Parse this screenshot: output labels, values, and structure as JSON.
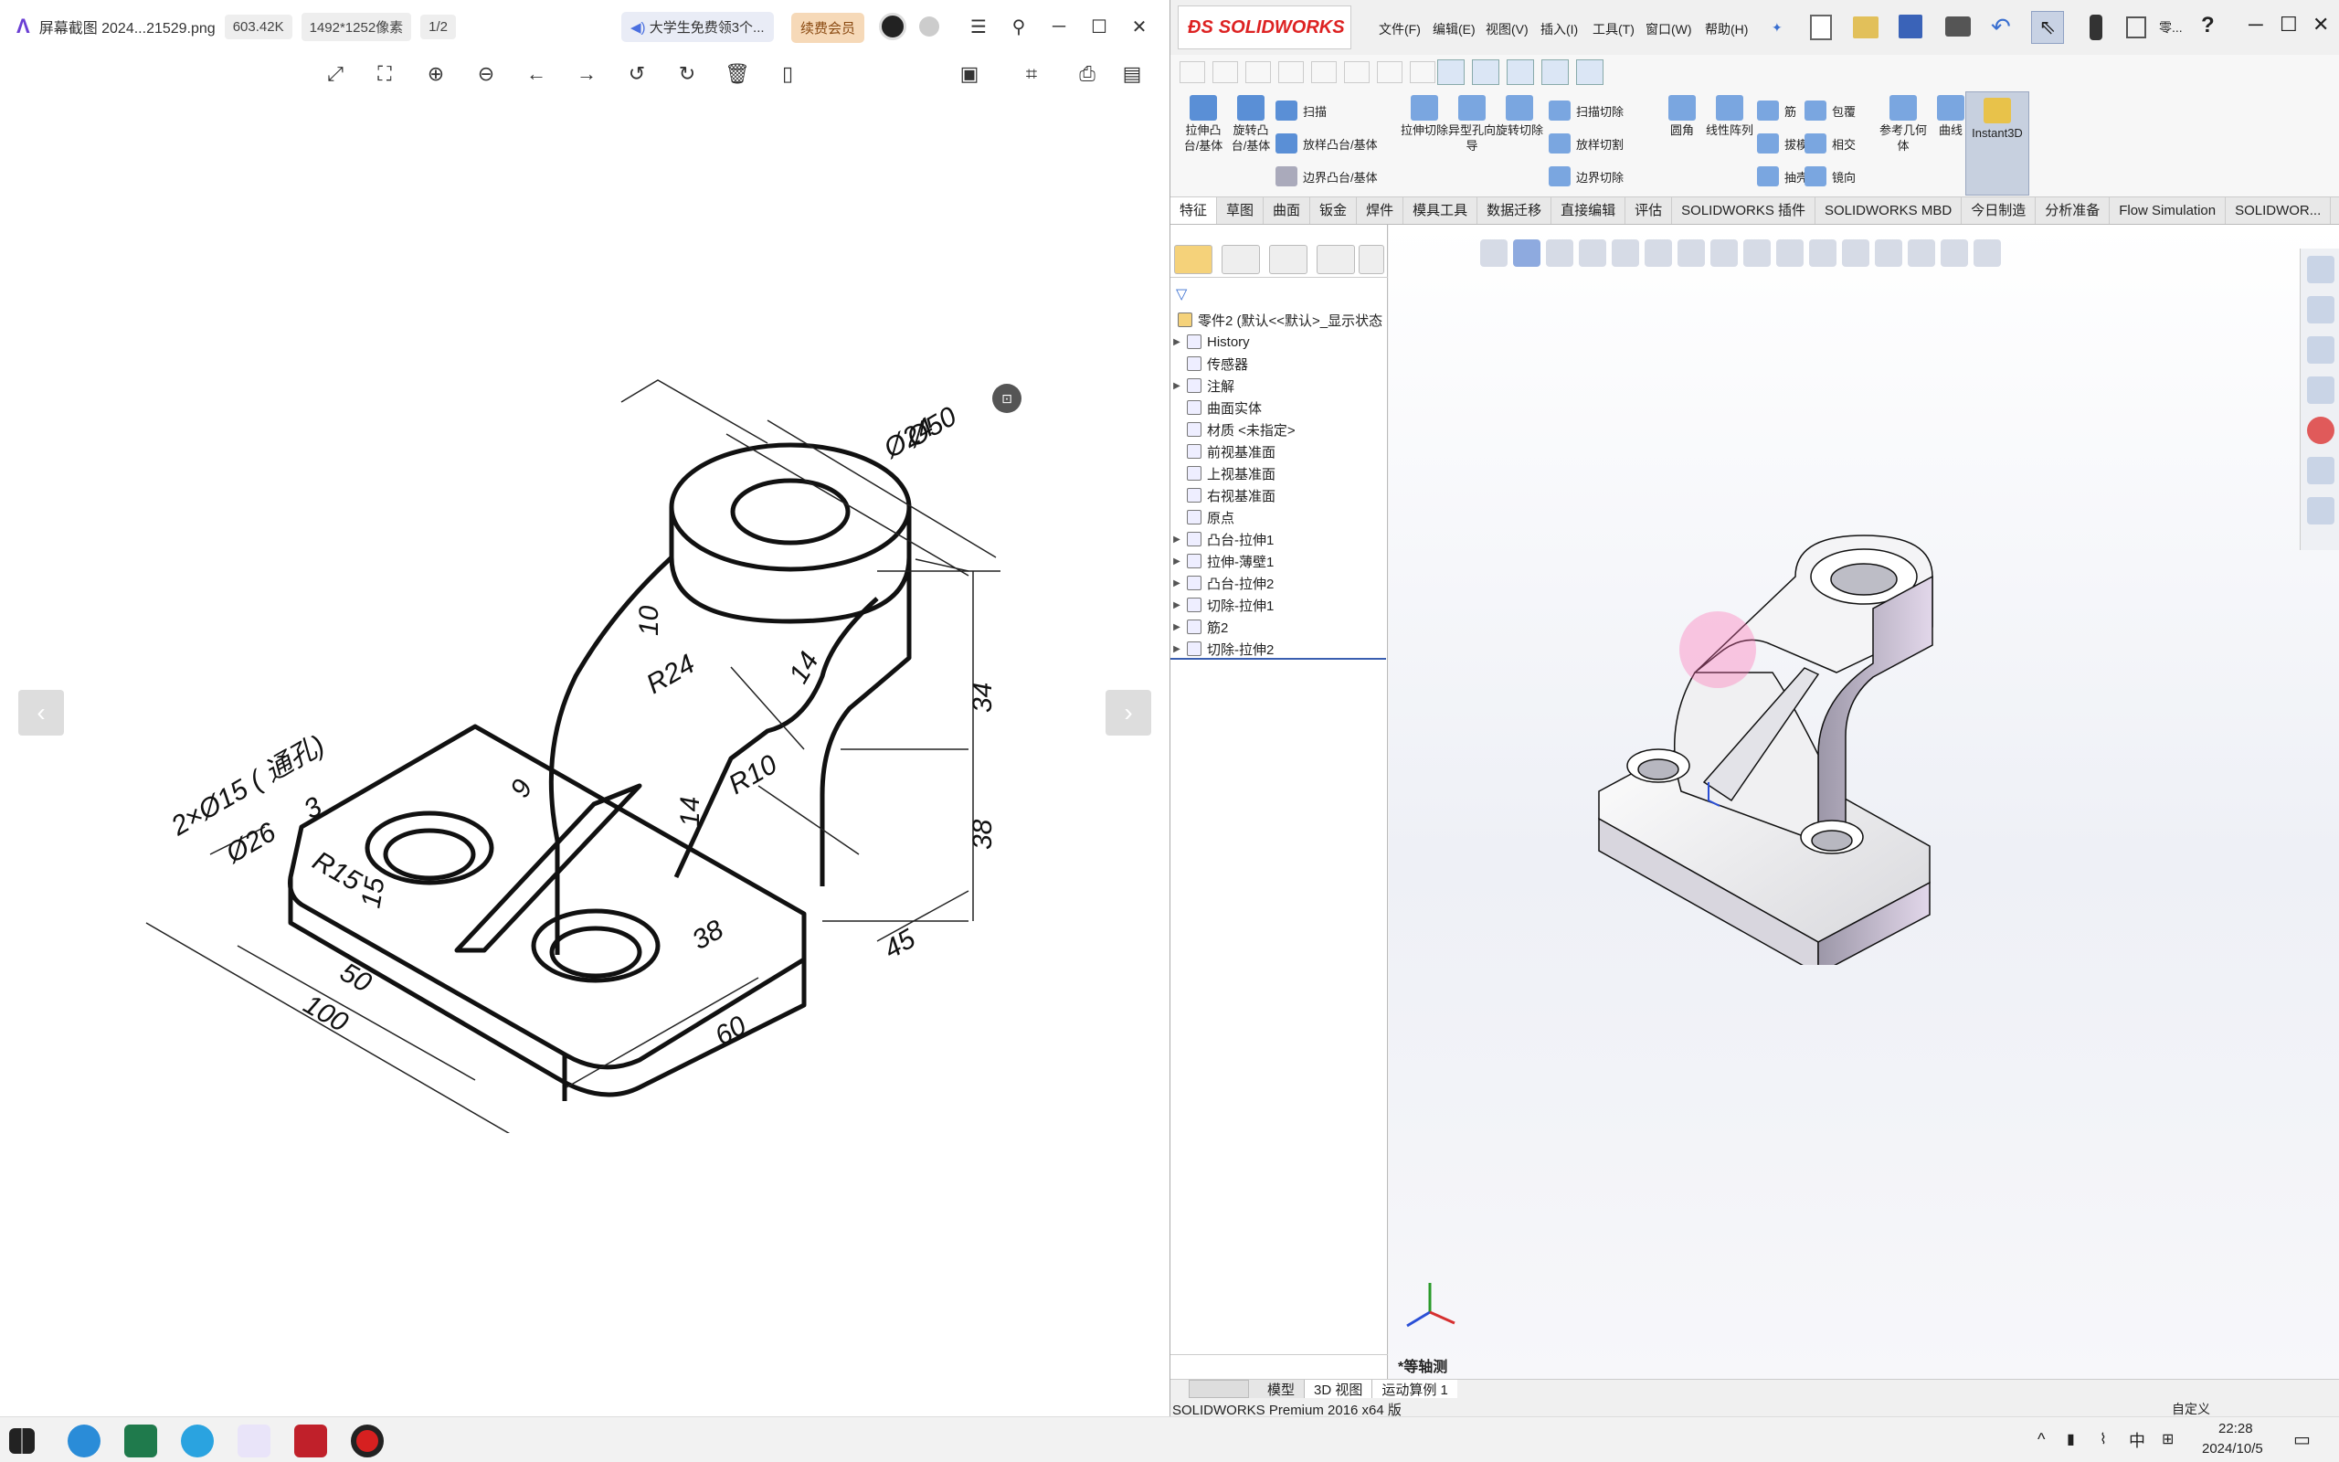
{
  "viewer": {
    "filename": "屏幕截图 2024...21529.png",
    "filesize": "603.42K",
    "dimensions": "1492*1252像素",
    "page": "1/2",
    "promo": "大学生免费领3个...",
    "vip": "续费会员"
  },
  "drawing": {
    "dims": [
      "Ø50",
      "Ø24",
      "10",
      "14",
      "34",
      "38",
      "R24",
      "R10",
      "9",
      "14",
      "15",
      "50",
      "100",
      "60",
      "45",
      "38",
      "R15"
    ],
    "hole_note": "2×Ø15 ( 通孔)",
    "counterbore": "Ø26",
    "depth": "3"
  },
  "sw": {
    "brand": "SOLIDWORKS",
    "menus": [
      "文件(F)",
      "编辑(E)",
      "视图(V)",
      "插入(I)",
      "工具(T)",
      "窗口(W)",
      "帮助(H)"
    ],
    "tool_right": "零...",
    "commands_big": [
      {
        "label": "拉伸凸台/基体",
        "color": "#5a8fd6"
      },
      {
        "label": "旋转凸台/基体",
        "color": "#5a8fd6"
      },
      {
        "label": "拉伸切除",
        "color": "#7aa6e0"
      },
      {
        "label": "异型孔向导",
        "color": "#7aa6e0"
      },
      {
        "label": "旋转切除",
        "color": "#7aa6e0"
      },
      {
        "label": "圆角",
        "color": "#7aa6e0"
      },
      {
        "label": "线性阵列",
        "color": "#7aa6e0"
      },
      {
        "label": "参考几何体",
        "color": "#7aa6e0"
      },
      {
        "label": "曲线",
        "color": "#7aa6e0"
      },
      {
        "label": "Instant3D",
        "color": "#e8c24a"
      }
    ],
    "commands_small": [
      "扫描",
      "放样凸台/基体",
      "边界凸台/基体",
      "扫描切除",
      "放样切割",
      "边界切除",
      "筋",
      "拔模",
      "抽壳",
      "包覆",
      "相交",
      "镜向"
    ],
    "tabs": [
      "特征",
      "草图",
      "曲面",
      "钣金",
      "焊件",
      "模具工具",
      "数据迁移",
      "直接编辑",
      "评估",
      "SOLIDWORKS 插件",
      "SOLIDWORKS MBD",
      "今日制造",
      "分析准备",
      "Flow Simulation",
      "SOLIDWOR..."
    ],
    "tree_root": "零件2 (默认<<默认>_显示状态",
    "tree": [
      {
        "label": "History",
        "expand": true
      },
      {
        "label": "传感器",
        "expand": false
      },
      {
        "label": "注解",
        "expand": true
      },
      {
        "label": "曲面实体",
        "expand": false
      },
      {
        "label": "材质 <未指定>",
        "expand": false
      },
      {
        "label": "前视基准面",
        "expand": false
      },
      {
        "label": "上视基准面",
        "expand": false
      },
      {
        "label": "右视基准面",
        "expand": false
      },
      {
        "label": "原点",
        "expand": false
      },
      {
        "label": "凸台-拉伸1",
        "expand": true
      },
      {
        "label": "拉伸-薄壁1",
        "expand": true
      },
      {
        "label": "凸台-拉伸2",
        "expand": true
      },
      {
        "label": "切除-拉伸1",
        "expand": true
      },
      {
        "label": "筋2",
        "expand": true
      },
      {
        "label": "切除-拉伸2",
        "expand": true
      }
    ],
    "view_label": "*等轴测",
    "bottom_tabs": [
      "模型",
      "3D 视图",
      "运动算例 1"
    ],
    "status": "SOLIDWORKS Premium 2016 x64 版",
    "status_right": "自定义"
  },
  "taskbar": {
    "time": "22:28",
    "date": "2024/10/5",
    "ime": "中"
  }
}
